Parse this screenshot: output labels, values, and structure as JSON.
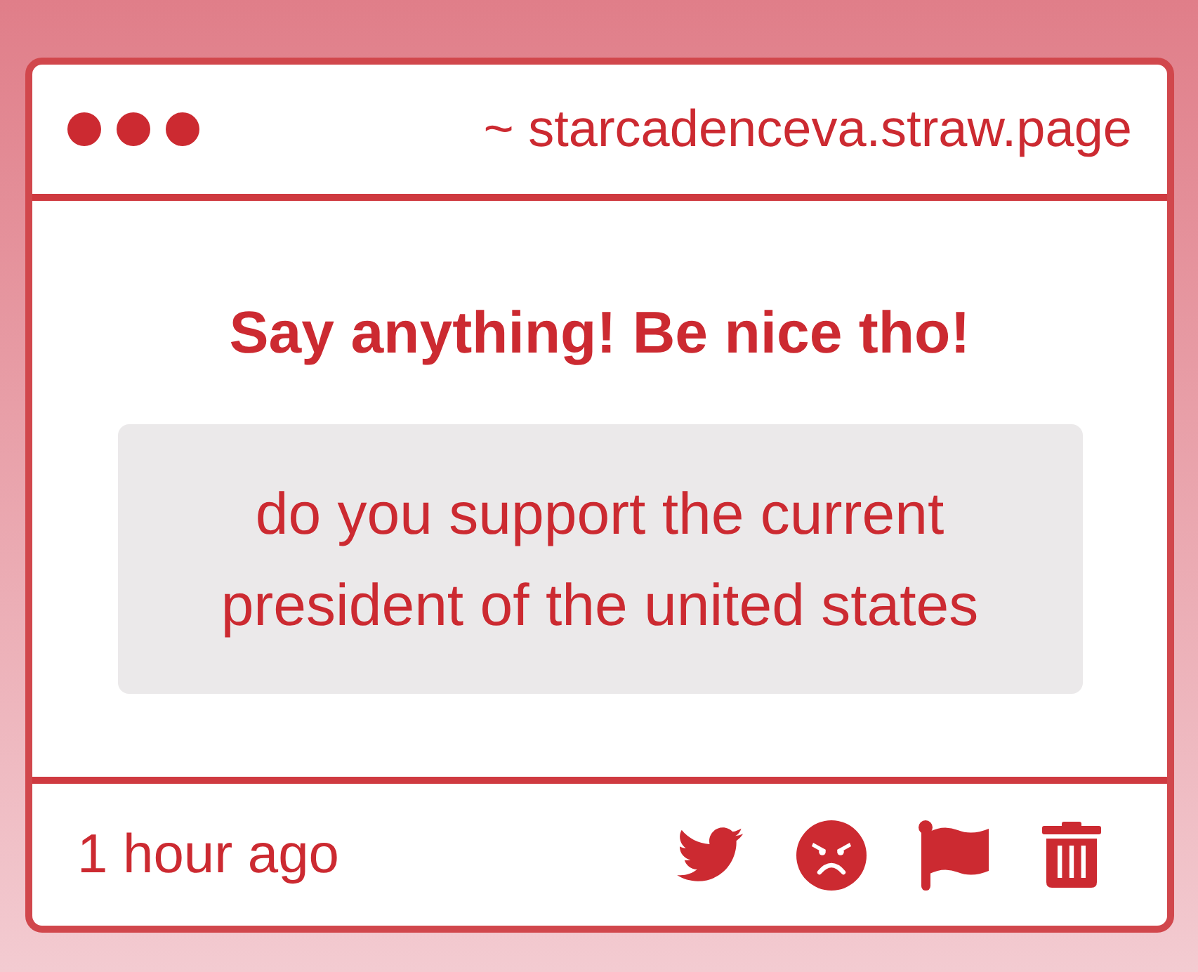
{
  "address_bar": {
    "url": "~ starcadenceva.straw.page"
  },
  "prompt": {
    "title": "Say anything! Be nice tho!"
  },
  "message": {
    "text": "do you support the current president of the united states"
  },
  "footer": {
    "time": "1 hour ago",
    "actions": [
      {
        "kind": "tweet"
      },
      {
        "kind": "react"
      },
      {
        "kind": "flag"
      },
      {
        "kind": "delete"
      }
    ]
  }
}
